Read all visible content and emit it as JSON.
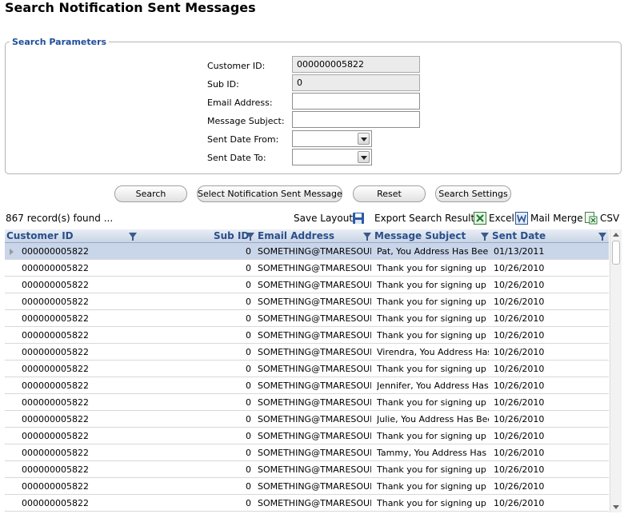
{
  "page_title": "Search Notification Sent Messages",
  "search_params": {
    "legend": "Search Parameters",
    "customer_id": {
      "label": "Customer ID:",
      "value": "000000005822"
    },
    "sub_id": {
      "label": "Sub ID:",
      "value": "0"
    },
    "email": {
      "label": "Email Address:",
      "value": ""
    },
    "subject": {
      "label": "Message Subject:",
      "value": ""
    },
    "date_from": {
      "label": "Sent Date From:",
      "value": ""
    },
    "date_to": {
      "label": "Sent Date To:",
      "value": ""
    }
  },
  "buttons": {
    "search": "Search",
    "select_message": "Select Notification Sent Message",
    "reset": "Reset",
    "settings": "Search Settings"
  },
  "toolbar": {
    "record_count": "867 record(s) found ...",
    "save_layout": "Save Layout",
    "export_label": "Export Search Results:",
    "excel": "Excel",
    "mail_merge": "Mail Merge",
    "csv": "CSV"
  },
  "grid": {
    "columns": [
      "Customer ID",
      "Sub ID",
      "Email Address",
      "Message Subject",
      "Sent Date"
    ],
    "rows": [
      [
        "000000005822",
        "0",
        "SOMETHING@TMARESOUR",
        "Pat, You Address Has Been",
        "01/13/2011"
      ],
      [
        "000000005822",
        "0",
        "SOMETHING@TMARESOUR",
        "Thank you for signing up to",
        "10/26/2010"
      ],
      [
        "000000005822",
        "0",
        "SOMETHING@TMARESOUR",
        "Thank you for signing up to",
        "10/26/2010"
      ],
      [
        "000000005822",
        "0",
        "SOMETHING@TMARESOUR",
        "Thank you for signing up to",
        "10/26/2010"
      ],
      [
        "000000005822",
        "0",
        "SOMETHING@TMARESOUR",
        "Thank you for signing up to",
        "10/26/2010"
      ],
      [
        "000000005822",
        "0",
        "SOMETHING@TMARESOUR",
        "Thank you for signing up to",
        "10/26/2010"
      ],
      [
        "000000005822",
        "0",
        "SOMETHING@TMARESOUR",
        "Virendra, You Address Has",
        "10/26/2010"
      ],
      [
        "000000005822",
        "0",
        "SOMETHING@TMARESOUR",
        "Thank you for signing up to",
        "10/26/2010"
      ],
      [
        "000000005822",
        "0",
        "SOMETHING@TMARESOUR",
        "Jennifer, You Address Has B",
        "10/26/2010"
      ],
      [
        "000000005822",
        "0",
        "SOMETHING@TMARESOUR",
        "Thank you for signing up to",
        "10/26/2010"
      ],
      [
        "000000005822",
        "0",
        "SOMETHING@TMARESOUR",
        "Julie, You Address Has Been",
        "10/26/2010"
      ],
      [
        "000000005822",
        "0",
        "SOMETHING@TMARESOUR",
        "Thank you for signing up to",
        "10/26/2010"
      ],
      [
        "000000005822",
        "0",
        "SOMETHING@TMARESOUR",
        "Tammy, You Address Has B",
        "10/26/2010"
      ],
      [
        "000000005822",
        "0",
        "SOMETHING@TMARESOUR",
        "Thank you for signing up to",
        "10/26/2010"
      ],
      [
        "000000005822",
        "0",
        "SOMETHING@TMARESOUR",
        "Thank you for signing up to",
        "10/26/2010"
      ],
      [
        "000000005822",
        "0",
        "SOMETHING@TMARESOUR",
        "Thank you for signing up to",
        "10/26/2010"
      ]
    ]
  }
}
